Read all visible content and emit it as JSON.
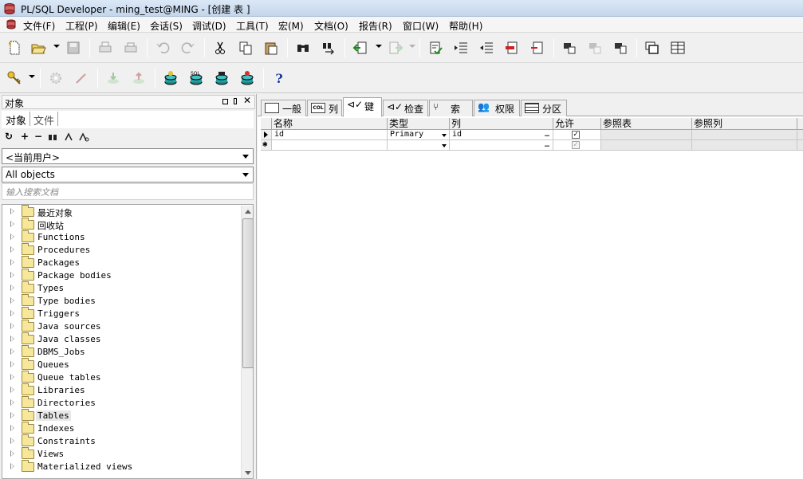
{
  "window": {
    "title": "PL/SQL Developer - ming_test@MING - [创建 表 ]"
  },
  "menu": [
    "文件(F)",
    "工程(P)",
    "编辑(E)",
    "会话(S)",
    "调试(D)",
    "工具(T)",
    "宏(M)",
    "文档(O)",
    "报告(R)",
    "窗口(W)",
    "帮助(H)"
  ],
  "help_glyph": "?",
  "left": {
    "panel_title": "对象",
    "tabs": [
      "对象",
      "文件"
    ],
    "user_combo": "<当前用户>",
    "type_combo": "All objects",
    "search_placeholder": "输入搜索文档",
    "tree": [
      "最近对象",
      "回收站",
      "Functions",
      "Procedures",
      "Packages",
      "Package bodies",
      "Types",
      "Type bodies",
      "Triggers",
      "Java sources",
      "Java classes",
      "DBMS_Jobs",
      "Queues",
      "Queue tables",
      "Libraries",
      "Directories",
      "Tables",
      "Indexes",
      "Constraints",
      "Views",
      "Materialized views"
    ],
    "selected_index": 16
  },
  "right": {
    "tabs": [
      "一般",
      "列",
      "键",
      "检查",
      "索引",
      "权限",
      "分区"
    ],
    "active_tab": 2,
    "columns": [
      "名称",
      "类型",
      "列",
      "允许",
      "参照表",
      "参照列"
    ],
    "rows": [
      {
        "name": "id",
        "type": "Primary",
        "col": "id",
        "allow": "✓"
      },
      {
        "name": "",
        "type": "",
        "col": "",
        "allow": "✓"
      }
    ],
    "new_row_marker": "✱",
    "ellipsis": "…"
  }
}
